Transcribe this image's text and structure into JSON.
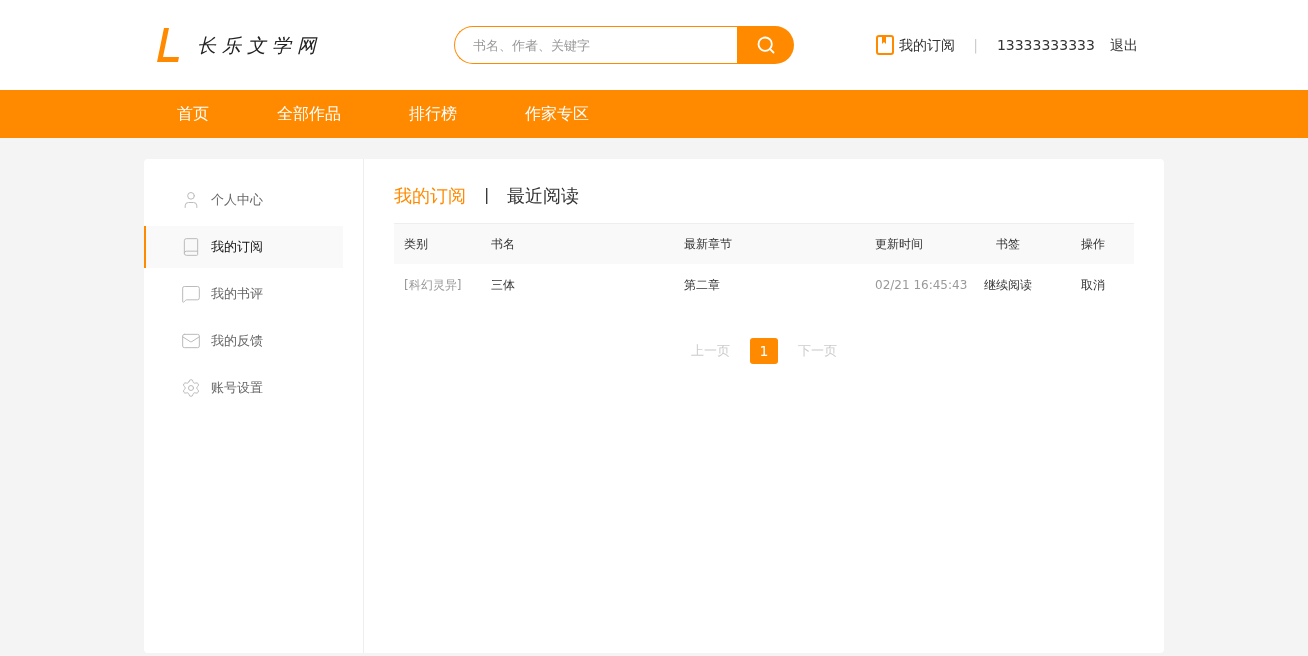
{
  "header": {
    "logo_text": "长 乐 文 学 网",
    "search": {
      "placeholder": "书名、作者、关键字"
    },
    "subscription_link": "我的订阅",
    "separator": "|",
    "phone": "13333333333",
    "logout": "退出"
  },
  "nav": {
    "items": [
      {
        "label": "首页",
        "selected": false
      },
      {
        "label": "全部作品",
        "selected": false
      },
      {
        "label": "排行榜",
        "selected": false
      },
      {
        "label": "作家专区",
        "selected": false
      }
    ]
  },
  "sidebar": {
    "items": [
      {
        "label": "个人中心",
        "selected": false
      },
      {
        "label": "我的订阅",
        "selected": true
      },
      {
        "label": "我的书评",
        "selected": false
      },
      {
        "label": "我的反馈",
        "selected": false
      },
      {
        "label": "账号设置",
        "selected": false
      }
    ]
  },
  "tabs": [
    {
      "label": "我的订阅",
      "selected": true
    },
    {
      "label": "最近阅读",
      "selected": false
    }
  ],
  "tab_separator": "|",
  "table": {
    "columns": [
      "类别",
      "书名",
      "最新章节",
      "更新时间",
      "书签",
      "操作"
    ],
    "rows": [
      {
        "category": "[科幻灵异]",
        "title": "三体",
        "latest_chapter": "第二章",
        "updated": "02/21 16:45:43",
        "bookmark": "继续阅读",
        "action": "取消"
      }
    ]
  },
  "pagination": {
    "prev": {
      "label": "上一页",
      "disabled": true
    },
    "pages": [
      {
        "label": "1",
        "selected": true
      }
    ],
    "next": {
      "label": "下一页",
      "disabled": true
    }
  }
}
